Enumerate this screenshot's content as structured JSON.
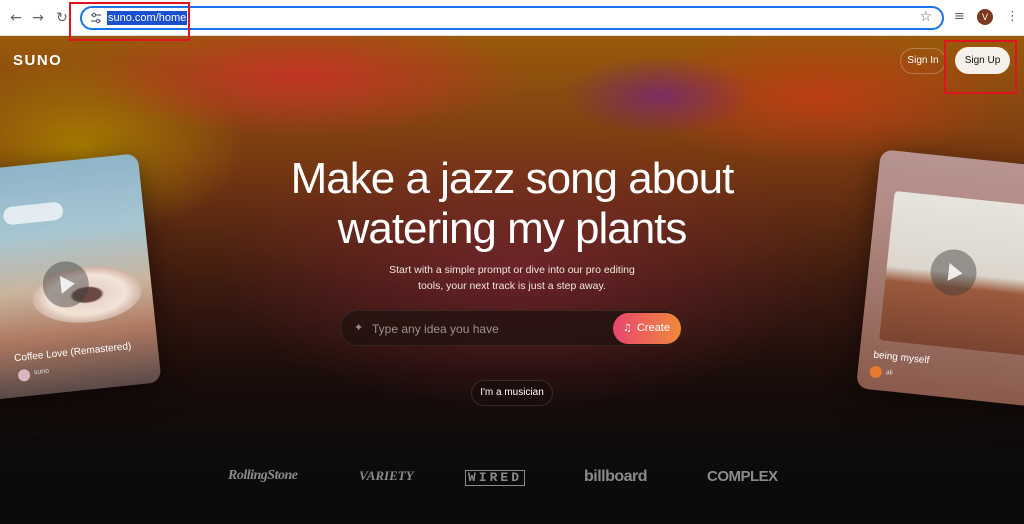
{
  "browser": {
    "url": "suno.com/home",
    "profile_initial": "V"
  },
  "header": {
    "logo": "SUNO",
    "sign_in": "Sign In",
    "sign_up": "Sign Up"
  },
  "hero": {
    "headline_line1": "Make a jazz song about",
    "headline_line2": "watering my plants",
    "sub_line1": "Start with a simple prompt or dive into our pro editing",
    "sub_line2": "tools, your next track is just a step away.",
    "prompt_placeholder": "Type any idea you have",
    "create_label": "Create",
    "musician_label": "I'm a musician"
  },
  "cards": {
    "left": {
      "title": "Coffee Love (Remastered)",
      "artist": "suno"
    },
    "right": {
      "title": "being myself",
      "artist": "ali"
    }
  },
  "press_logos": [
    "RollingStone",
    "VARIETY",
    "WIRED",
    "billboard",
    "COMPLEX"
  ],
  "annotations": {
    "highlight_color": "#e0141e"
  }
}
